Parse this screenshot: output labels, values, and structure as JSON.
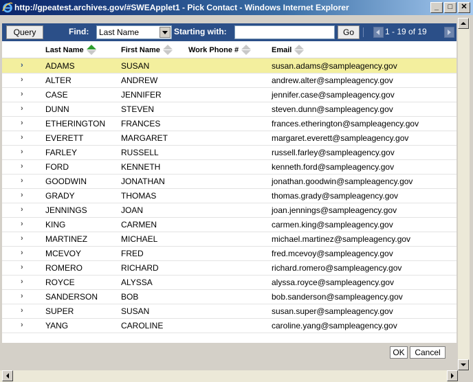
{
  "window": {
    "title": "http://gpeatest.archives.gov/#SWEApplet1 - Pick Contact - Windows Internet Explorer",
    "minimize": "_",
    "maximize": "□",
    "close": "✕"
  },
  "toolbar": {
    "query_label": "Query",
    "find_label": "Find:",
    "find_value": "Last Name",
    "starting_label": "Starting with:",
    "starting_value": "",
    "go_label": "Go",
    "record_count": "1 - 19 of 19"
  },
  "columns": [
    {
      "label": "Last Name",
      "sorted": "ascending"
    },
    {
      "label": "First Name",
      "sorted": "none"
    },
    {
      "label": "Work Phone #",
      "sorted": "none"
    },
    {
      "label": "Email",
      "sorted": "none"
    }
  ],
  "rows": [
    {
      "last": "ADAMS",
      "first": "SUSAN",
      "phone": "",
      "email": "susan.adams@sampleagency.gov",
      "selected": true
    },
    {
      "last": "ALTER",
      "first": "ANDREW",
      "phone": "",
      "email": "andrew.alter@sampleagency.gov"
    },
    {
      "last": "CASE",
      "first": "JENNIFER",
      "phone": "",
      "email": "jennifer.case@sampleagency.gov"
    },
    {
      "last": "DUNN",
      "first": "STEVEN",
      "phone": "",
      "email": "steven.dunn@sampleagency.gov"
    },
    {
      "last": "ETHERINGTON",
      "first": "FRANCES",
      "phone": "",
      "email": "frances.etherington@sampleagency.gov"
    },
    {
      "last": "EVERETT",
      "first": "MARGARET",
      "phone": "",
      "email": "margaret.everett@sampleagency.gov"
    },
    {
      "last": "FARLEY",
      "first": "RUSSELL",
      "phone": "",
      "email": "russell.farley@sampleagency.gov"
    },
    {
      "last": "FORD",
      "first": "KENNETH",
      "phone": "",
      "email": "kenneth.ford@sampleagency.gov"
    },
    {
      "last": "GOODWIN",
      "first": "JONATHAN",
      "phone": "",
      "email": "jonathan.goodwin@sampleagency.gov"
    },
    {
      "last": "GRADY",
      "first": "THOMAS",
      "phone": "",
      "email": "thomas.grady@sampleagency.gov"
    },
    {
      "last": "JENNINGS",
      "first": "JOAN",
      "phone": "",
      "email": "joan.jennings@sampleagency.gov"
    },
    {
      "last": "KING",
      "first": "CARMEN",
      "phone": "",
      "email": "carmen.king@sampleagency.gov"
    },
    {
      "last": "MARTINEZ",
      "first": "MICHAEL",
      "phone": "",
      "email": "michael.martinez@sampleagency.gov"
    },
    {
      "last": "MCEVOY",
      "first": "FRED",
      "phone": "",
      "email": "fred.mcevoy@sampleagency.gov"
    },
    {
      "last": "ROMERO",
      "first": "RICHARD",
      "phone": "",
      "email": "richard.romero@sampleagency.gov"
    },
    {
      "last": "ROYCE",
      "first": "ALYSSA",
      "phone": "",
      "email": "alyssa.royce@sampleagency.gov"
    },
    {
      "last": "SANDERSON",
      "first": "BOB",
      "phone": "",
      "email": "bob.sanderson@sampleagency.gov"
    },
    {
      "last": "SUPER",
      "first": "SUSAN",
      "phone": "",
      "email": "susan.super@sampleagency.gov"
    },
    {
      "last": "YANG",
      "first": "CAROLINE",
      "phone": "",
      "email": "caroline.yang@sampleagency.gov"
    }
  ],
  "footer": {
    "ok_label": "OK",
    "cancel_label": "Cancel"
  },
  "icons": {
    "browser": "ie-logo-icon",
    "row_selector": "chevron-right-icon",
    "sort": "sort-arrows-icon"
  },
  "colors": {
    "toolbar_bg": "#2b4f88",
    "selected_row": "#f3ef9e",
    "sort_active": "#2e9d2e"
  }
}
